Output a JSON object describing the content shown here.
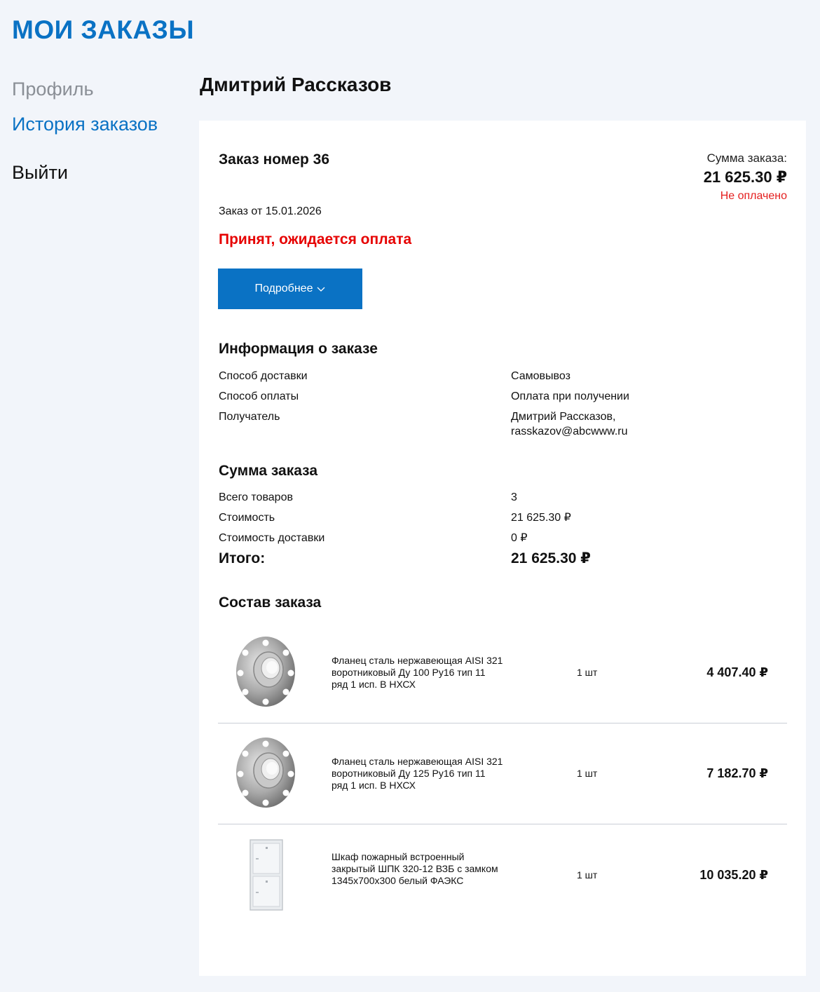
{
  "page": {
    "title": "МОИ ЗАКАЗЫ"
  },
  "sidebar": {
    "profile": "Профиль",
    "history": "История заказов",
    "logout": "Выйти"
  },
  "user": {
    "name": "Дмитрий Рассказов"
  },
  "order": {
    "number_label": "Заказ номер 36",
    "sum_label": "Сумма заказа:",
    "sum_value": "21 625.30 ₽",
    "payment_status": "Не оплачено",
    "date_label": "Заказ от 15.01.2026",
    "status": "Принят, ожидается оплата",
    "details_button": "Подробнее"
  },
  "info": {
    "title": "Информация о заказе",
    "rows": [
      {
        "label": "Способ доставки",
        "value": "Самовывоз"
      },
      {
        "label": "Способ оплаты",
        "value": "Оплата при получении"
      },
      {
        "label": "Получатель",
        "value": "Дмитрий Рассказов, rasskazov@abcwww.ru"
      }
    ]
  },
  "summary": {
    "title": "Сумма заказа",
    "rows": [
      {
        "label": "Всего товаров",
        "value": "3"
      },
      {
        "label": "Стоимость",
        "value": "21 625.30 ₽"
      },
      {
        "label": "Стоимость доставки",
        "value": "0 ₽"
      }
    ],
    "total_label": "Итого:",
    "total_value": "21 625.30 ₽"
  },
  "composition": {
    "title": "Состав заказа",
    "items": [
      {
        "name": "Фланец сталь нержавеющая AISI 321 воротниковый Ду 100 Ру16 тип 11 ряд 1 исп. В НХСХ",
        "qty": "1 шт",
        "price": "4 407.40 ₽",
        "image": "flange-image"
      },
      {
        "name": "Фланец сталь нержавеющая AISI 321 воротниковый Ду 125 Ру16 тип 11 ряд 1 исп. В НХСХ",
        "qty": "1 шт",
        "price": "7 182.70 ₽",
        "image": "flange-image"
      },
      {
        "name": "Шкаф пожарный встроенный закрытый ШПК 320-12 ВЗБ с замком 1345х700х300 белый ФАЭКС",
        "qty": "1 шт",
        "price": "10 035.20 ₽",
        "image": "cabinet-image"
      }
    ]
  },
  "colors": {
    "brand": "#0a72c4",
    "alert": "#e60000",
    "background": "#f2f5fa"
  },
  "icons": {
    "details_chevron": "chevron-down-icon"
  }
}
